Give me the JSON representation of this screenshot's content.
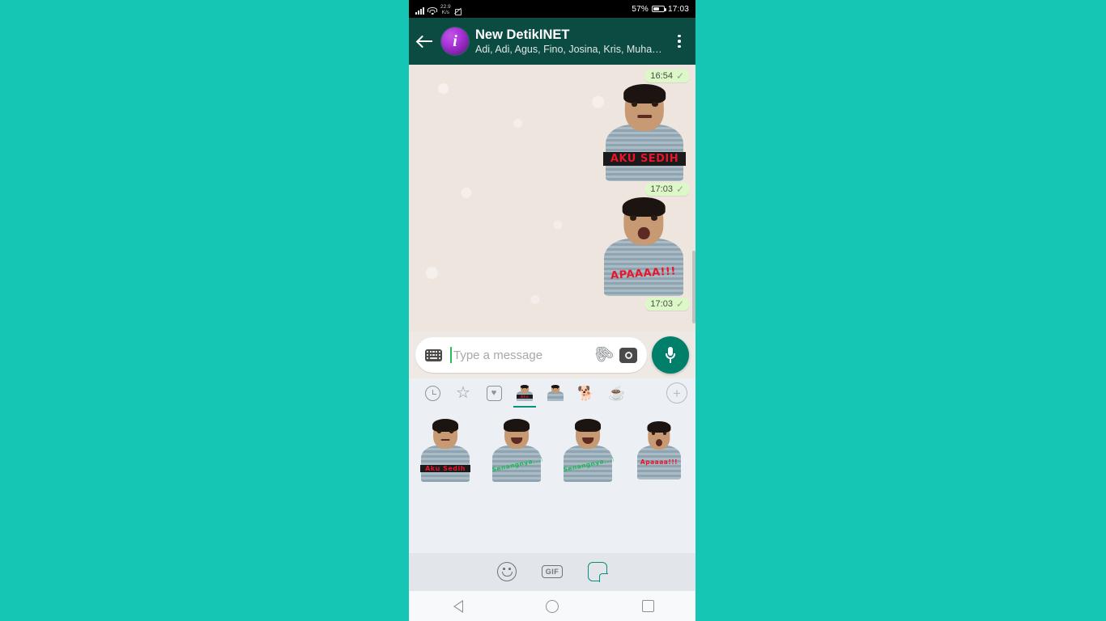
{
  "statusbar": {
    "net_speed_value": "22.9",
    "net_speed_unit": "K/s",
    "battery_percent": "57%",
    "clock": "17:03",
    "icons": [
      "signal-icon",
      "wifi-icon",
      "mute-icon",
      "battery-icon"
    ]
  },
  "header": {
    "back_label": "back-arrow-icon",
    "avatar_letter": "i",
    "title": "New DetikINET",
    "subtitle": "Adi, Adi, Agus, Fino, Josina, Kris, Muham…",
    "menu_label": "overflow-menu-icon",
    "bg_color": "#0c4b42"
  },
  "chat": {
    "messages": [
      {
        "time": "16:54",
        "tick": "✓",
        "sticker_caption": "AKU SEDIH",
        "caption_color": "#e8152b",
        "caption_bg": "#1b1b1b",
        "mood": "sad"
      },
      {
        "time": "17:03",
        "tick": "✓",
        "sticker_caption": "APAAAA!!!",
        "caption_color": "#e8152b",
        "caption_bg": "transparent",
        "mood": "shocked"
      },
      {
        "time": "17:03",
        "tick": "✓"
      }
    ]
  },
  "input": {
    "keyboard_icon": "keyboard-icon",
    "placeholder": "Type a message",
    "value": "",
    "attach_icon": "paperclip-icon",
    "camera_icon": "camera-icon",
    "mic_icon": "microphone-icon",
    "mic_color": "#00806a"
  },
  "sticker_panel": {
    "tabs": [
      {
        "name": "recent-stickers",
        "icon": "clock-icon",
        "active": false
      },
      {
        "name": "starred-stickers",
        "icon": "star-icon",
        "active": false
      },
      {
        "name": "favorite-stickers",
        "icon": "heart-box-icon",
        "active": false
      },
      {
        "name": "pack-detikinet",
        "icon": "person-sticker-icon",
        "active": true
      },
      {
        "name": "pack-person-two",
        "icon": "person-sticker-icon",
        "active": false
      },
      {
        "name": "pack-dog",
        "icon": "dog-sticker-icon",
        "active": false
      },
      {
        "name": "pack-cup",
        "icon": "cup-sticker-icon",
        "active": false
      }
    ],
    "add_pack_label": "+",
    "stickers": [
      {
        "caption": "Aku Sedih",
        "color": "#e8152b",
        "bg": "#1b1b1b",
        "mood": "sad"
      },
      {
        "caption": "Senangnya...!!!",
        "color": "#1db954",
        "bg": "transparent",
        "mood": "happy"
      },
      {
        "caption": "Senangnya...!!!",
        "color": "#1db954",
        "bg": "transparent",
        "mood": "happy"
      },
      {
        "caption": "Apaaaa!!!",
        "color": "#e8152b",
        "bg": "transparent",
        "mood": "shocked"
      }
    ]
  },
  "bottom_tabs": [
    {
      "name": "emoji-tab",
      "icon": "smiley-icon",
      "label": "",
      "active": false
    },
    {
      "name": "gif-tab",
      "icon": "gif-icon",
      "label": "GIF",
      "active": false
    },
    {
      "name": "sticker-tab",
      "icon": "sticker-icon",
      "label": "",
      "active": true
    }
  ],
  "navbar": [
    {
      "name": "nav-back-button",
      "icon": "triangle-back-icon"
    },
    {
      "name": "nav-home-button",
      "icon": "circle-home-icon"
    },
    {
      "name": "nav-recents-button",
      "icon": "square-recents-icon"
    }
  ],
  "page": {
    "background_color": "#16c6b5"
  }
}
